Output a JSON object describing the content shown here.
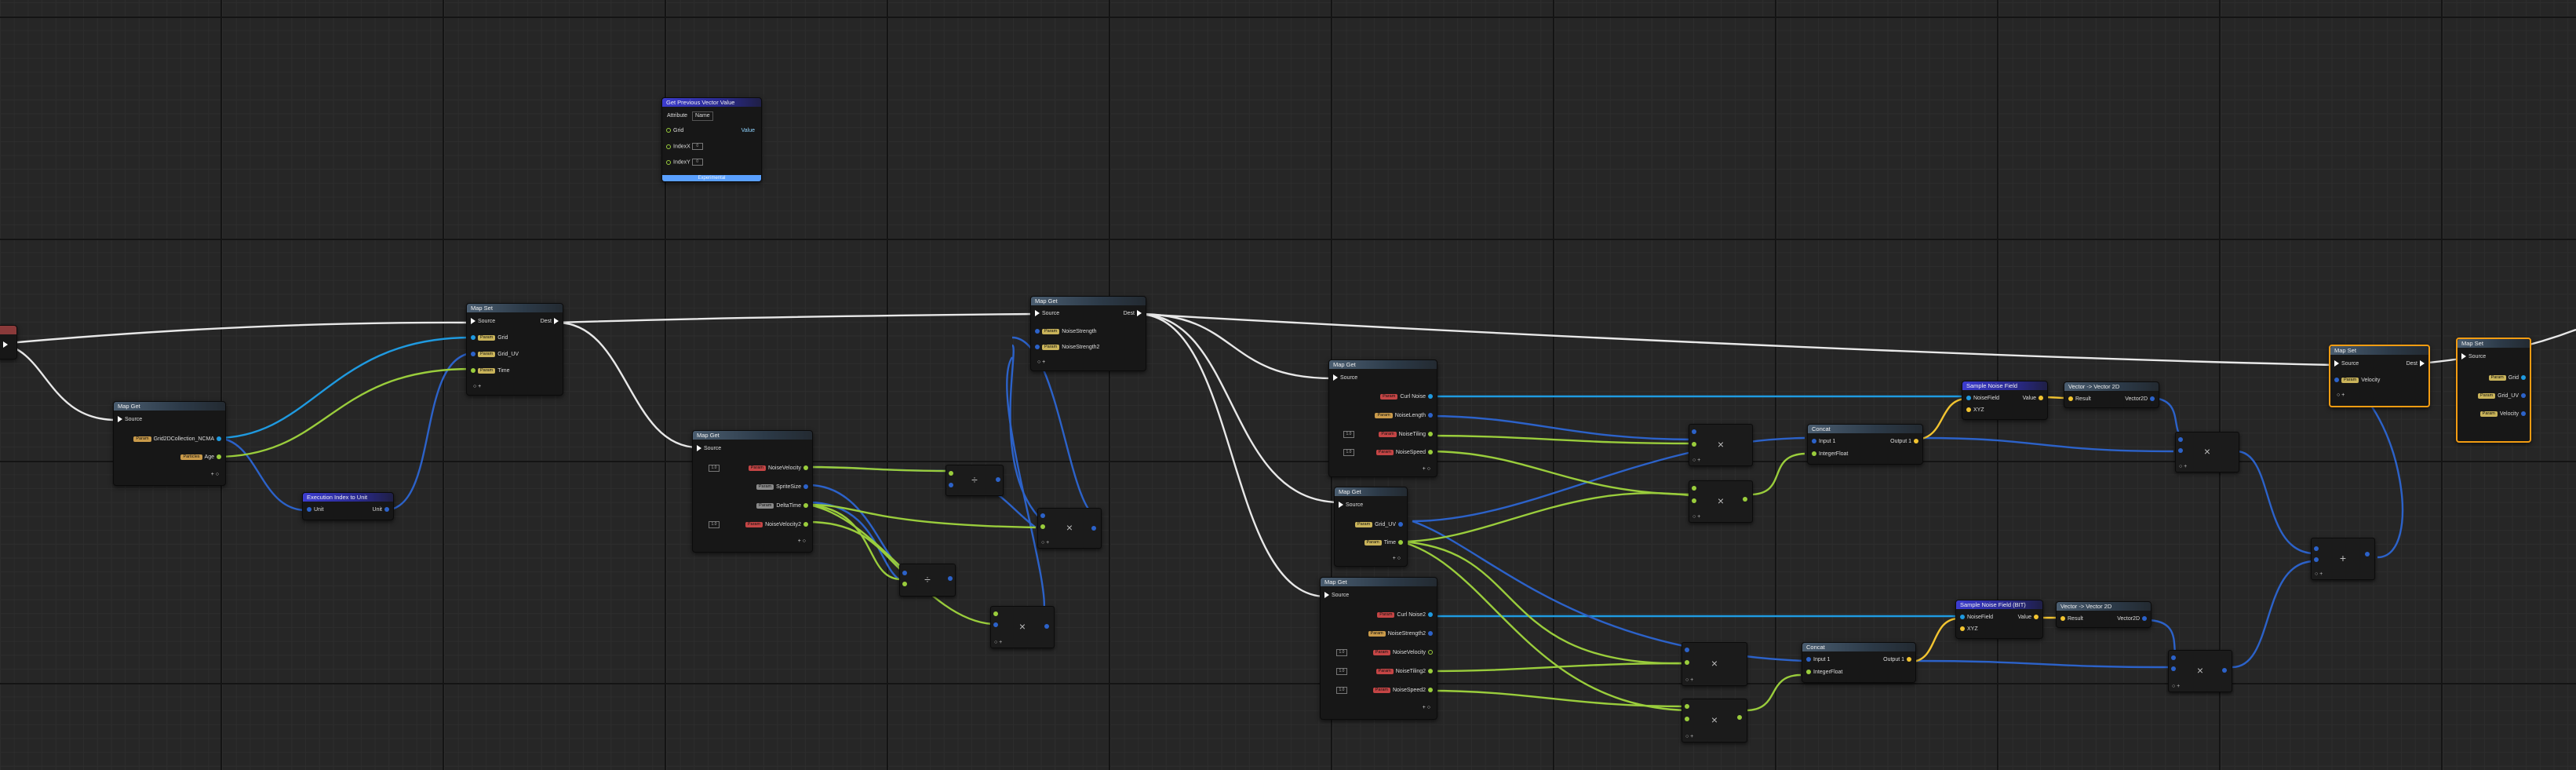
{
  "graph": {
    "colors": {
      "exec": "#ffffff",
      "blue": "#1f9ae0",
      "green": "#9acd3c",
      "yellow": "#f2c431",
      "dark_blue": "#2c62c9"
    },
    "nodes": {
      "get_prev": {
        "title": "Get Previous Vector Value",
        "attribute_label": "Attribute",
        "attribute_value": "Name",
        "grid_label": "Grid",
        "value_label": "Value",
        "indexx_label": "IndexX",
        "indexx_value": "0",
        "indexy_label": "IndexY",
        "indexy_value": "0",
        "footer": "Experimental"
      },
      "map_set_a": {
        "title": "Map Get",
        "source": "Source",
        "grid_label": "Grid2DCollection_NCMA",
        "age_label": "Age"
      },
      "execution_index": {
        "title": "Execution Index to Unit",
        "unit_in": "Unit",
        "unit_out": "Unit"
      },
      "map_get_top": {
        "title": "Map Set",
        "source": "Source",
        "dest": "Dest",
        "grid": "Grid",
        "grid_uv": "Grid_UV",
        "time": "Time"
      },
      "map_get_b": {
        "title": "Map Get",
        "source": "Source",
        "noise_velocity": "NoiseVelocity",
        "sprite_size": "SpriteSize",
        "delta_time": "DeltaTime",
        "noise_velocity2": "NoiseVelocity2"
      },
      "map_get_noise": {
        "title": "Map Get",
        "source": "Source",
        "dest": "Dest",
        "noise_strength": "NoiseStrength",
        "noise_strength2": "NoiseStrength2"
      },
      "map_get_c": {
        "title": "Map Get",
        "source": "Source",
        "curl_noise": "Curl Noise",
        "noise_length": "NoiseLength",
        "noise_tiling": "NoiseTiling",
        "noise_speed": "NoiseSpeed"
      },
      "map_get_d": {
        "title": "Map Get",
        "source": "Source",
        "grid_uv": "Grid_UV",
        "time": "Time"
      },
      "map_get_e": {
        "title": "Map Get",
        "source": "Source",
        "curl_noise2": "Curl Noise2",
        "noise_strength2": "NoiseStrength2",
        "noise_velocity": "NoiseVelocity",
        "noise_tiling2": "NoiseTiling2",
        "noise_speed2": "NoiseSpeed2"
      },
      "sample_noise_1": {
        "title": "Sample Noise Field",
        "noise_field": "NoiseField",
        "value": "Value",
        "xyz": "XYZ"
      },
      "sample_noise_2": {
        "title": "Sample Noise Field (BIT)",
        "noise_field": "NoiseField",
        "value": "Value",
        "xyz": "XYZ"
      },
      "vector_to_2d_1": {
        "title": "Vector -> Vector 2D",
        "result": "Result",
        "vector2d": "Vector2D"
      },
      "vector_to_2d_2": {
        "title": "Vector -> Vector 2D",
        "result": "Result",
        "vector2d": "Vector2D"
      },
      "concat_1": {
        "title": "Concat",
        "input1": "Input 1",
        "output1": "Output 1",
        "integer_float": "IntegerFloat"
      },
      "concat_2": {
        "title": "Concat",
        "input1": "Input 1",
        "output1": "Output 1",
        "integer_float": "IntegerFloat"
      },
      "map_set_right": {
        "title": "Map Set",
        "source": "Source",
        "dest": "Dest",
        "velocity": "Velocity"
      },
      "map_set_far": {
        "title": "Map Set",
        "source": "Source",
        "grid": "Grid",
        "grid_uv": "Grid_UV",
        "velocity": "Velocity"
      }
    },
    "ops": {
      "mul": "×",
      "add": "+",
      "div": "÷"
    }
  }
}
